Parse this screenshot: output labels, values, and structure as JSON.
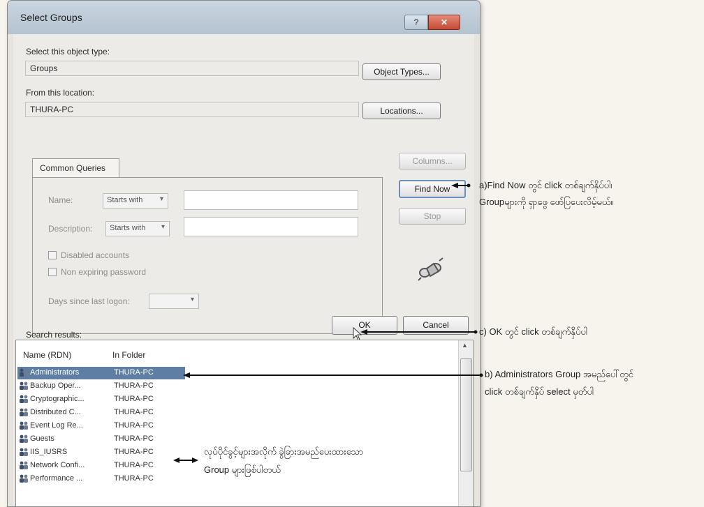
{
  "dialog": {
    "title": "Select Groups",
    "help_glyph": "?",
    "close_glyph": "✕",
    "object_type_label": "Select this object type:",
    "object_type_value": "Groups",
    "object_types_button": "Object Types...",
    "location_label": "From this location:",
    "location_value": "THURA-PC",
    "locations_button": "Locations...",
    "tab_label": "Common Queries",
    "name_label": "Name:",
    "name_mode": "Starts with",
    "description_label": "Description:",
    "description_mode": "Starts with",
    "disabled_accounts_label": "Disabled accounts",
    "non_expiring_label": "Non expiring password",
    "days_label": "Days since last logon:",
    "columns_button": "Columns...",
    "find_now_button": "Find Now",
    "stop_button": "Stop",
    "search_results_label": "Search results:",
    "ok_button": "OK",
    "cancel_button": "Cancel",
    "columns": [
      "Name (RDN)",
      "In Folder"
    ],
    "rows": [
      {
        "name": "Administrators",
        "folder": "THURA-PC",
        "selected": true
      },
      {
        "name": "Backup Oper...",
        "folder": "THURA-PC"
      },
      {
        "name": "Cryptographic...",
        "folder": "THURA-PC"
      },
      {
        "name": "Distributed C...",
        "folder": "THURA-PC"
      },
      {
        "name": "Event Log Re...",
        "folder": "THURA-PC"
      },
      {
        "name": "Guests",
        "folder": "THURA-PC"
      },
      {
        "name": "IIS_IUSRS",
        "folder": "THURA-PC"
      },
      {
        "name": "Network Confi...",
        "folder": "THURA-PC"
      },
      {
        "name": "Performance ...",
        "folder": "THURA-PC"
      }
    ]
  },
  "annotations": {
    "a_line1": "a)Find Now တွင် click တစ်ချက်နှိပ်ပါ၊",
    "a_line2": "Groupများကို ရှာဖွေ ဖော်ပြပေးလိမ့်မယ်။",
    "b_line1": "b) Administrators Group အမည်ပေါ်တွင်",
    "b_line2": "click တစ်ချက်နှိပ် select မှတ်ပါ",
    "c_line1": "c) OK တွင် click တစ်ချက်နှိပ်ပါ",
    "d_line1": "လုပ်ပိုင်ခွင့်များအလိုက် ခွဲခြားအမည်ပေးထားသော",
    "d_line2": "Group များဖြစ်ပါတယ်"
  },
  "colors": {
    "selection": "#5e7fa3",
    "close_button": "#c44a33",
    "window_face": "#ecebe7"
  },
  "icons": {
    "group_row": "group-icon",
    "search_graphic": "binoculars-icon"
  }
}
